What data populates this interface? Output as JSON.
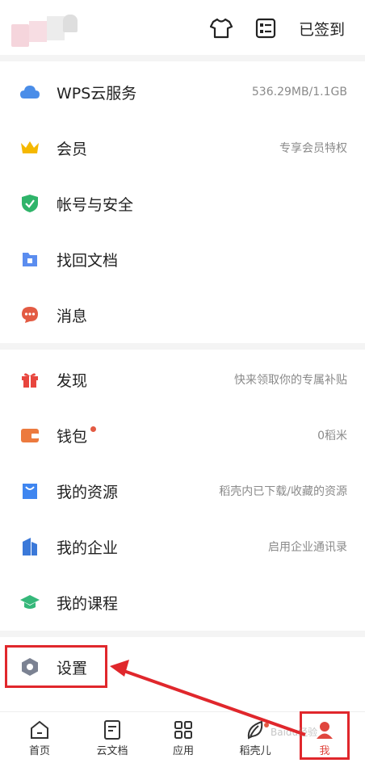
{
  "header": {
    "checkin_label": "已签到"
  },
  "section1": [
    {
      "label": "WPS云服务",
      "value": "536.29MB/1.1GB",
      "icon": "cloud-icon"
    },
    {
      "label": "会员",
      "value": "专享会员特权",
      "icon": "crown-icon"
    },
    {
      "label": "帐号与安全",
      "value": "",
      "icon": "shield-icon"
    },
    {
      "label": "找回文档",
      "value": "",
      "icon": "folder-icon"
    },
    {
      "label": "消息",
      "value": "",
      "icon": "chat-bubble-icon"
    }
  ],
  "section2": [
    {
      "label": "发现",
      "value": "快来领取你的专属补贴",
      "icon": "gift-icon"
    },
    {
      "label": "钱包",
      "value": "0稻米",
      "icon": "wallet-icon"
    },
    {
      "label": "我的资源",
      "value": "稻壳内已下载/收藏的资源",
      "icon": "bag-icon"
    },
    {
      "label": "我的企业",
      "value": "启用企业通讯录",
      "icon": "building-icon"
    },
    {
      "label": "我的课程",
      "value": "",
      "icon": "graduation-cap-icon"
    }
  ],
  "section3": [
    {
      "label": "设置",
      "value": "",
      "icon": "hexagon-settings-icon"
    }
  ],
  "bottom_nav": [
    {
      "label": "首页",
      "icon": "home-icon"
    },
    {
      "label": "云文档",
      "icon": "document-icon"
    },
    {
      "label": "应用",
      "icon": "grid-icon"
    },
    {
      "label": "稻壳儿",
      "icon": "leaf-icon"
    },
    {
      "label": "我",
      "icon": "person-icon"
    }
  ],
  "watermark": "Baidu经验",
  "colors": {
    "cloud": "#4a8de8",
    "crown": "#f5b800",
    "shield": "#2fb46a",
    "folder": "#5b8def",
    "chat": "#e35b43",
    "gift": "#e8463e",
    "wallet": "#ec7a3e",
    "bag": "#3f86f0",
    "building": "#3b79d9",
    "cap": "#35b87a",
    "settings": "#7b8292",
    "highlight": "#e0272c",
    "nav_active": "#e0463e"
  }
}
